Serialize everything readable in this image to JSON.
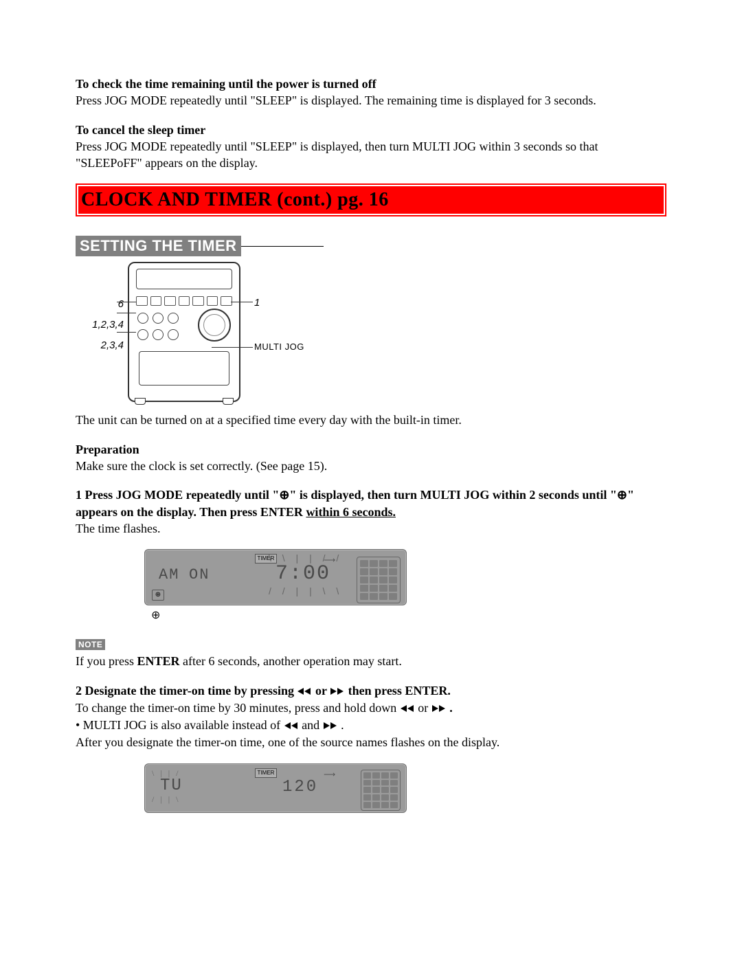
{
  "sections": {
    "check_time": {
      "heading": "To check the time remaining until the power is turned off",
      "body": "Press JOG MODE repeatedly until \"SLEEP\" is displayed. The remaining time is displayed for 3 seconds."
    },
    "cancel_sleep": {
      "heading": "To cancel the sleep timer",
      "body": "Press JOG MODE repeatedly until \"SLEEP\" is displayed, then turn MULTI JOG within 3 seconds so that \"SLEEPoFF\" appears on the display."
    },
    "banner": "CLOCK AND TIMER (cont.)    pg. 16",
    "sub_heading": "SETTING THE TIMER",
    "diagram_labels": {
      "left": [
        "6",
        "1,2,3,4",
        "2,3,4"
      ],
      "right_1": "1",
      "right_mj": "MULTI JOG"
    },
    "intro": "The unit can be turned on at a specified time every day with the built-in timer.",
    "prep_heading": "Preparation",
    "prep_body": "Make sure the clock is set correctly. (See page 15).",
    "step1": {
      "bold_a": "1 Press JOG MODE repeatedly until \"",
      "icon1": "⊕",
      "bold_b": "\" is displayed, then turn MULTI JOG within 2 seconds until \"",
      "icon2": "⊕",
      "bold_c": "\" appears on the display. Then press ENTER ",
      "uline": "within 6 seconds.",
      "body": "The time flashes."
    },
    "lcd1": {
      "tag": "TIMER",
      "left1": "AM",
      "left2": "ON",
      "center": "7:00",
      "clock_icon": "⊕",
      "under_icon": "⊕"
    },
    "note_label": "NOTE",
    "note_body_a": "If you press ",
    "note_body_b": "ENTER",
    "note_body_c": " after 6 seconds, another operation may start.",
    "step2": {
      "bold_a": "2 Designate the timer-on time by pressing ",
      "bold_b": " or ",
      "bold_c": " then press ENTER.",
      "line2_a": "To change the timer-on time by 30 minutes, press and hold down ",
      "line2_b": " or ",
      "line2_c": ".",
      "line3_a": "• MULTI JOG is also available instead of ",
      "line3_b": " and ",
      "line3_c": ".",
      "line4": "After you designate the timer-on time, one of the source names flashes on the display."
    },
    "lcd2": {
      "tag": "TIMER",
      "left": "TU",
      "center": "120"
    }
  }
}
